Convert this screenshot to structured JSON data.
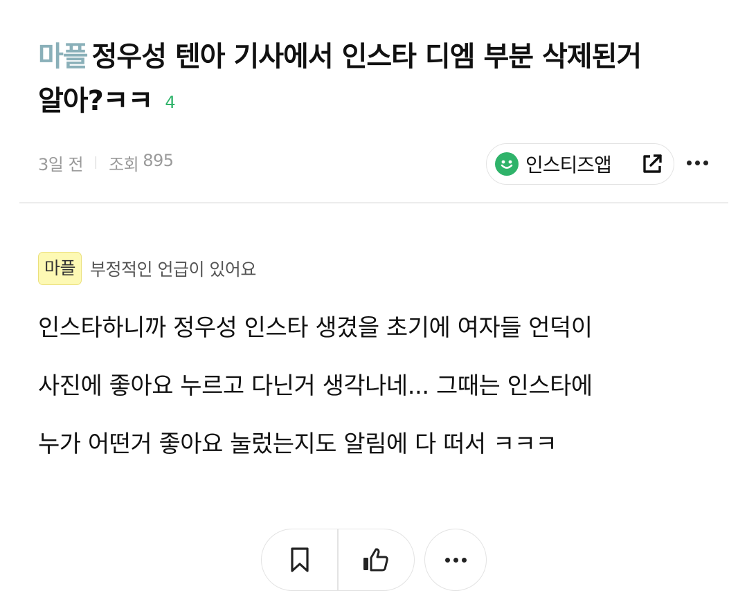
{
  "post": {
    "category": "마플",
    "title_line1": "정우성 텐아 기사에서 인스타 디엠 부분 삭제된거",
    "title_line2": "알아?ㅋㅋ",
    "comment_count": "4"
  },
  "meta": {
    "time": "3일 전",
    "views_label": "조회",
    "views_count": "895"
  },
  "app_button": {
    "label": "인스티즈앱"
  },
  "notice": {
    "badge": "마플",
    "text": "부정적인 언급이 있어요"
  },
  "body": {
    "lines": [
      "인스타하니까 정우성 인스타 생겼을 초기에 여자들 언덕이",
      "사진에 좋아요 누르고 다닌거 생각나네... 그때는 인스타에",
      "누가 어떤거 좋아요 눌렀는지도 알림에 다 떠서 ㅋㅋㅋ"
    ]
  },
  "icons": {
    "smile": "smile-icon",
    "external_link": "external-link-icon",
    "more": "more-icon",
    "bookmark": "bookmark-icon",
    "thumbs_up": "thumbs-up-icon"
  },
  "colors": {
    "category": "#8ab0b9",
    "comment_count": "#2fb36a",
    "brand_green": "#2fb36a",
    "badge_bg": "#fdf9b4"
  }
}
